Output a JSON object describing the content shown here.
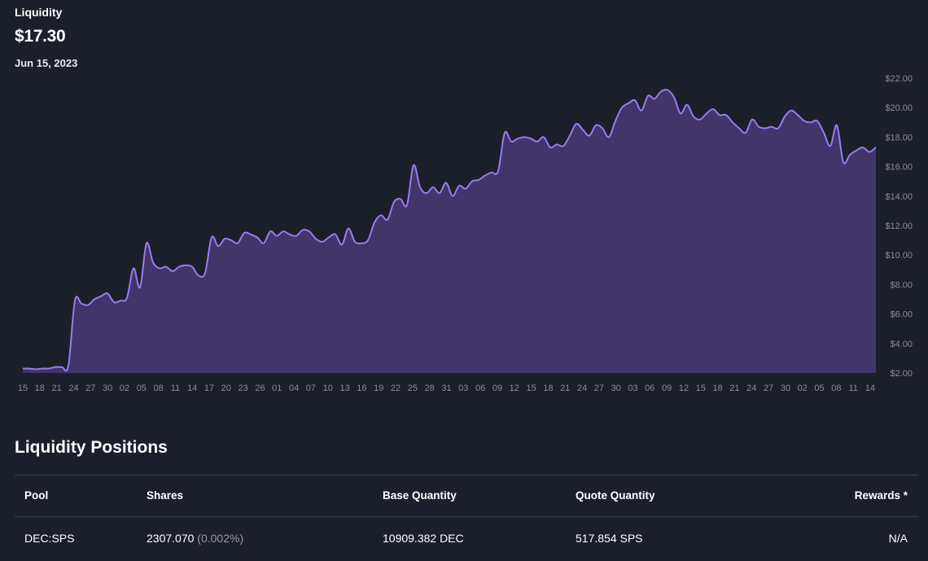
{
  "header": {
    "label": "Liquidity",
    "value": "$17.30",
    "date": "Jun 15, 2023"
  },
  "colors": {
    "background": "#1b1f2a",
    "line": "#9b7bf0",
    "area": "#413569",
    "axis_text": "#8a8d98"
  },
  "chart_data": {
    "type": "area",
    "title": "",
    "xlabel": "",
    "ylabel": "",
    "ylim": [
      2,
      22
    ],
    "y_ticks": [
      "$2.00",
      "$4.00",
      "$6.00",
      "$8.00",
      "$10.00",
      "$12.00",
      "$14.00",
      "$16.00",
      "$18.00",
      "$20.00",
      "$22.00"
    ],
    "y_tick_values": [
      2,
      4,
      6,
      8,
      10,
      12,
      14,
      16,
      18,
      20,
      22
    ],
    "x_ticks": [
      "15",
      "18",
      "21",
      "24",
      "27",
      "30",
      "02",
      "05",
      "08",
      "11",
      "14",
      "17",
      "20",
      "23",
      "26",
      "01",
      "04",
      "07",
      "10",
      "13",
      "16",
      "19",
      "22",
      "25",
      "28",
      "31",
      "03",
      "06",
      "09",
      "12",
      "15",
      "18",
      "21",
      "24",
      "27",
      "30",
      "03",
      "06",
      "09",
      "12",
      "15",
      "18",
      "21",
      "24",
      "27",
      "30",
      "02",
      "05",
      "08",
      "11",
      "14"
    ],
    "series": [
      {
        "values": [
          2.3,
          2.3,
          2.25,
          2.3,
          2.3,
          2.4,
          2.4,
          2.5,
          6.9,
          6.7,
          6.6,
          7.0,
          7.2,
          7.4,
          6.8,
          6.9,
          7.1,
          9.1,
          7.8,
          10.8,
          9.5,
          9.1,
          9.2,
          8.9,
          9.2,
          9.3,
          9.2,
          8.6,
          8.8,
          11.2,
          10.6,
          11.1,
          11.0,
          10.8,
          11.5,
          11.4,
          11.2,
          10.8,
          11.6,
          11.3,
          11.6,
          11.4,
          11.3,
          11.7,
          11.6,
          11.1,
          10.9,
          11.2,
          11.4,
          10.7,
          11.8,
          10.9,
          10.8,
          11.0,
          12.2,
          12.7,
          12.4,
          13.6,
          13.8,
          13.4,
          16.1,
          14.6,
          14.2,
          14.6,
          14.2,
          14.9,
          14.0,
          14.7,
          14.5,
          15.0,
          15.1,
          15.4,
          15.6,
          15.7,
          18.3,
          17.7,
          17.9,
          18.0,
          17.9,
          17.7,
          18.0,
          17.3,
          17.5,
          17.4,
          18.1,
          18.9,
          18.5,
          18.1,
          18.8,
          18.6,
          18.0,
          19.1,
          20.0,
          20.3,
          20.5,
          19.8,
          20.8,
          20.6,
          21.1,
          21.2,
          20.7,
          19.6,
          20.2,
          19.4,
          19.2,
          19.6,
          19.9,
          19.5,
          19.5,
          19.0,
          18.6,
          18.3,
          19.2,
          18.7,
          18.6,
          18.7,
          18.6,
          19.4,
          19.8,
          19.5,
          19.1,
          19.0,
          19.1,
          18.3,
          17.4,
          18.8,
          16.3,
          16.8,
          17.1,
          17.3,
          17.0,
          17.3
        ]
      }
    ]
  },
  "positions": {
    "title": "Liquidity Positions",
    "columns": {
      "pool": "Pool",
      "shares": "Shares",
      "base": "Base Quantity",
      "quote": "Quote Quantity",
      "rewards": "Rewards *"
    },
    "rows": [
      {
        "pool": "DEC:SPS",
        "shares": "2307.070",
        "shares_pct": "(0.002%)",
        "base": "10909.382 DEC",
        "quote": "517.854 SPS",
        "rewards": "N/A"
      }
    ]
  }
}
